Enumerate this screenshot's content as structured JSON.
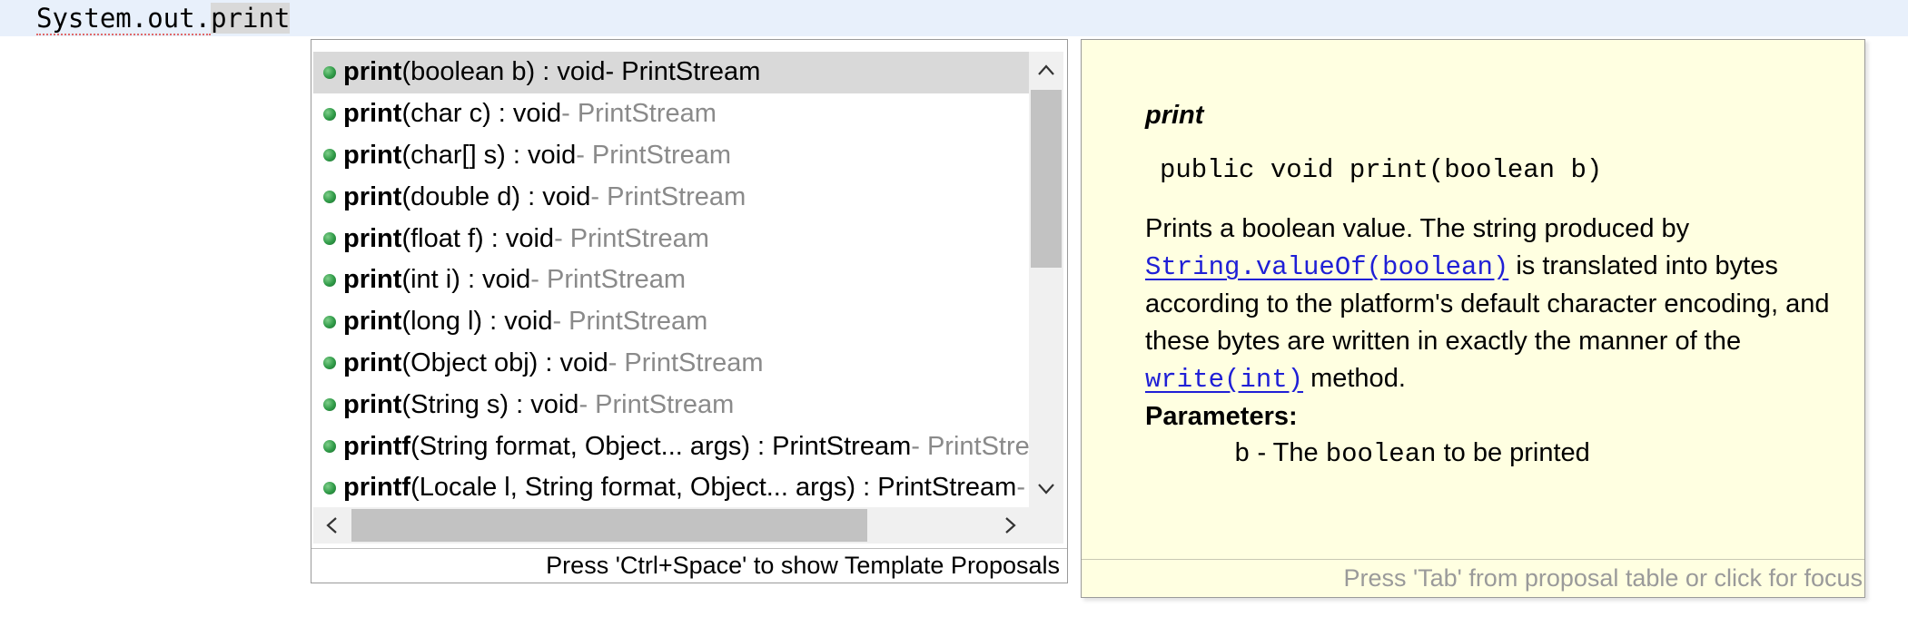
{
  "editor": {
    "code_object": "System.out.",
    "code_typed": "print"
  },
  "proposals": {
    "items": [
      {
        "name": "print",
        "params": "(boolean b) : void",
        "owner": " - PrintStream"
      },
      {
        "name": "print",
        "params": "(char c) : void",
        "owner": " - PrintStream"
      },
      {
        "name": "print",
        "params": "(char[] s) : void",
        "owner": " - PrintStream"
      },
      {
        "name": "print",
        "params": "(double d) : void",
        "owner": " - PrintStream"
      },
      {
        "name": "print",
        "params": "(float f) : void",
        "owner": " - PrintStream"
      },
      {
        "name": "print",
        "params": "(int i) : void",
        "owner": " - PrintStream"
      },
      {
        "name": "print",
        "params": "(long l) : void",
        "owner": " - PrintStream"
      },
      {
        "name": "print",
        "params": "(Object obj) : void",
        "owner": " - PrintStream"
      },
      {
        "name": "print",
        "params": "(String s) : void",
        "owner": " - PrintStream"
      },
      {
        "name": "printf",
        "params": "(String format, Object... args) : PrintStream",
        "owner": " - PrintStream"
      },
      {
        "name": "printf",
        "params": "(Locale l, String format, Object... args) : PrintStream",
        "owner": " - PrintStream"
      }
    ],
    "selected_index": 0,
    "status": "Press 'Ctrl+Space' to show Template Proposals",
    "scroll_up_icon": "chevron-up-icon",
    "scroll_down_icon": "chevron-down-icon",
    "scroll_left_icon": "chevron-left-icon",
    "scroll_right_icon": "chevron-right-icon"
  },
  "doc": {
    "title": "print",
    "signature": "public void print(boolean b)",
    "desc_1": "Prints a boolean value. The string produced by ",
    "link_1": "String.valueOf(boolean)",
    "desc_2": " is translated into bytes according to the platform's default character encoding, and these bytes are written in exactly the manner of the ",
    "link_2": "write(int)",
    "desc_3": " method.",
    "params_label": "Parameters:",
    "param_name": "b",
    "param_sep": " - The ",
    "param_type": "boolean",
    "param_rest": " to be printed",
    "footer": "Press 'Tab' from proposal table or click for focus"
  },
  "colors": {
    "editor_line": "#e8f0fb",
    "doc_background": "#ffffe1",
    "link": "#1f1fd6",
    "selection": "#d9d9d9",
    "method_icon": "#2f9a47"
  }
}
